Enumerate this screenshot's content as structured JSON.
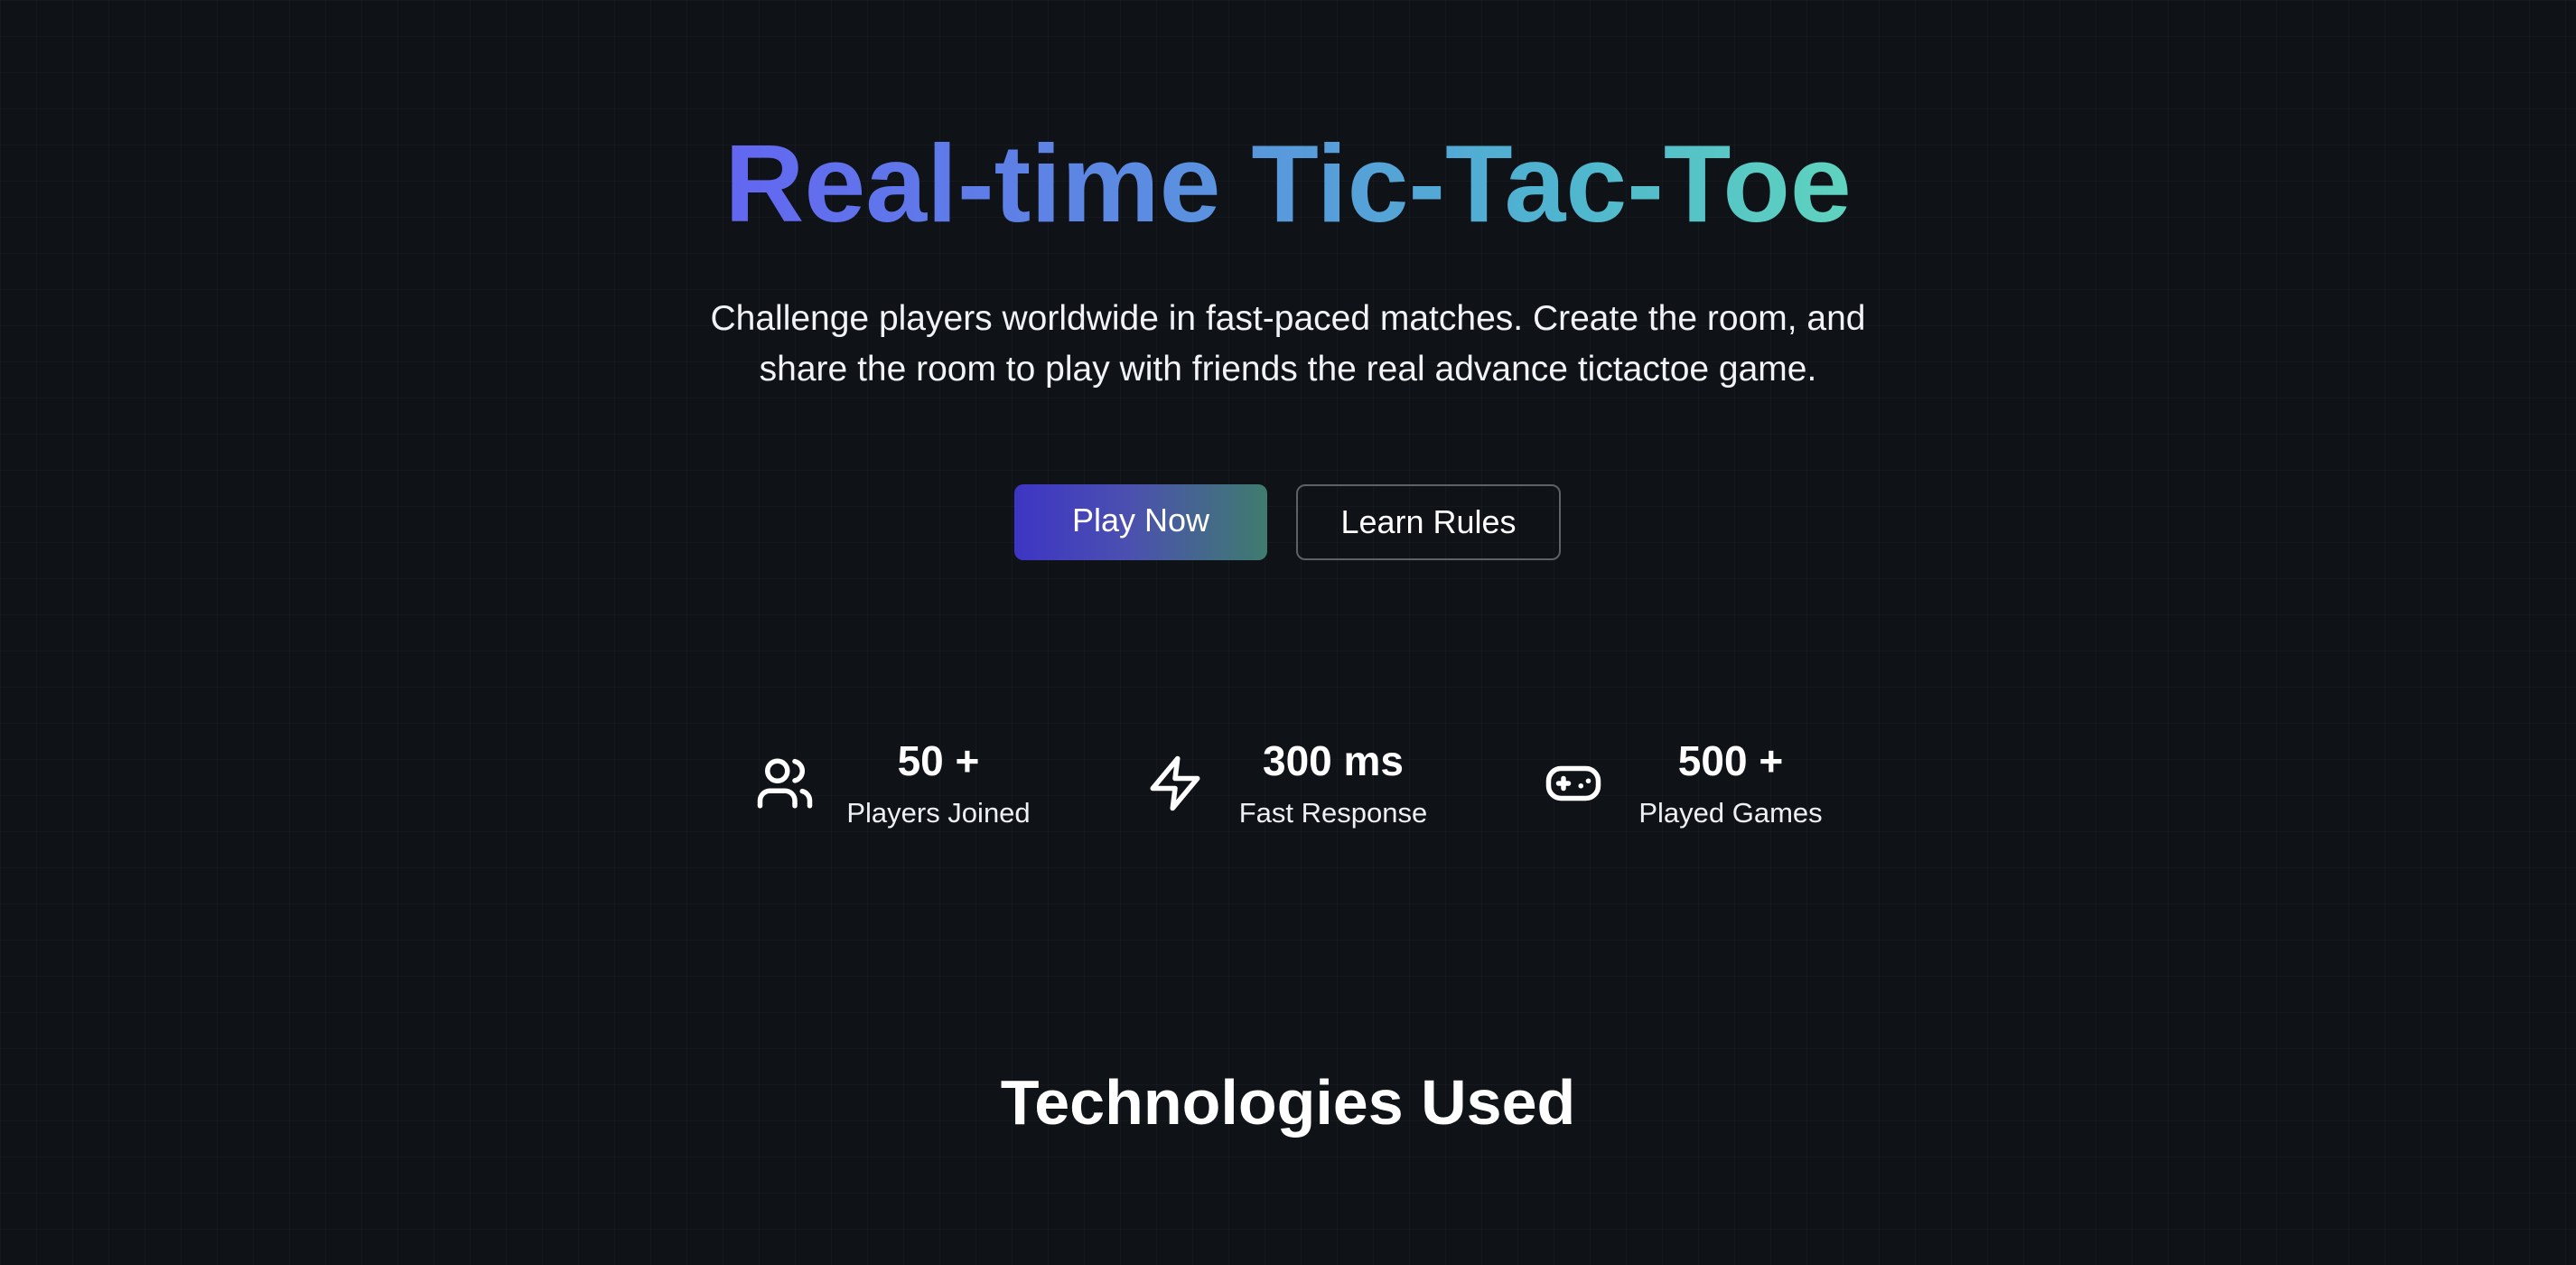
{
  "hero": {
    "title": "Real-time Tic-Tac-Toe",
    "subtitle_line1": "Challenge players worldwide in fast-paced matches. Create the room, and",
    "subtitle_line2": "share the room to play with friends the real advance tictactoe game.",
    "primary_button": "Play Now",
    "secondary_button": "Learn Rules"
  },
  "stats": [
    {
      "icon": "users-icon",
      "value": "50 +",
      "label": "Players Joined"
    },
    {
      "icon": "lightning-icon",
      "value": "300 ms",
      "label": "Fast Response"
    },
    {
      "icon": "gamepad-icon",
      "value": "500 +",
      "label": "Played Games"
    }
  ],
  "technologies": {
    "title": "Technologies Used"
  },
  "colors": {
    "background": "#0f1217",
    "title_gradient_start": "#6366f1",
    "title_gradient_end": "#5fd4bd",
    "button_gradient_start": "#3d35c4",
    "button_gradient_end": "#3f7c6e",
    "text": "#ffffff"
  }
}
